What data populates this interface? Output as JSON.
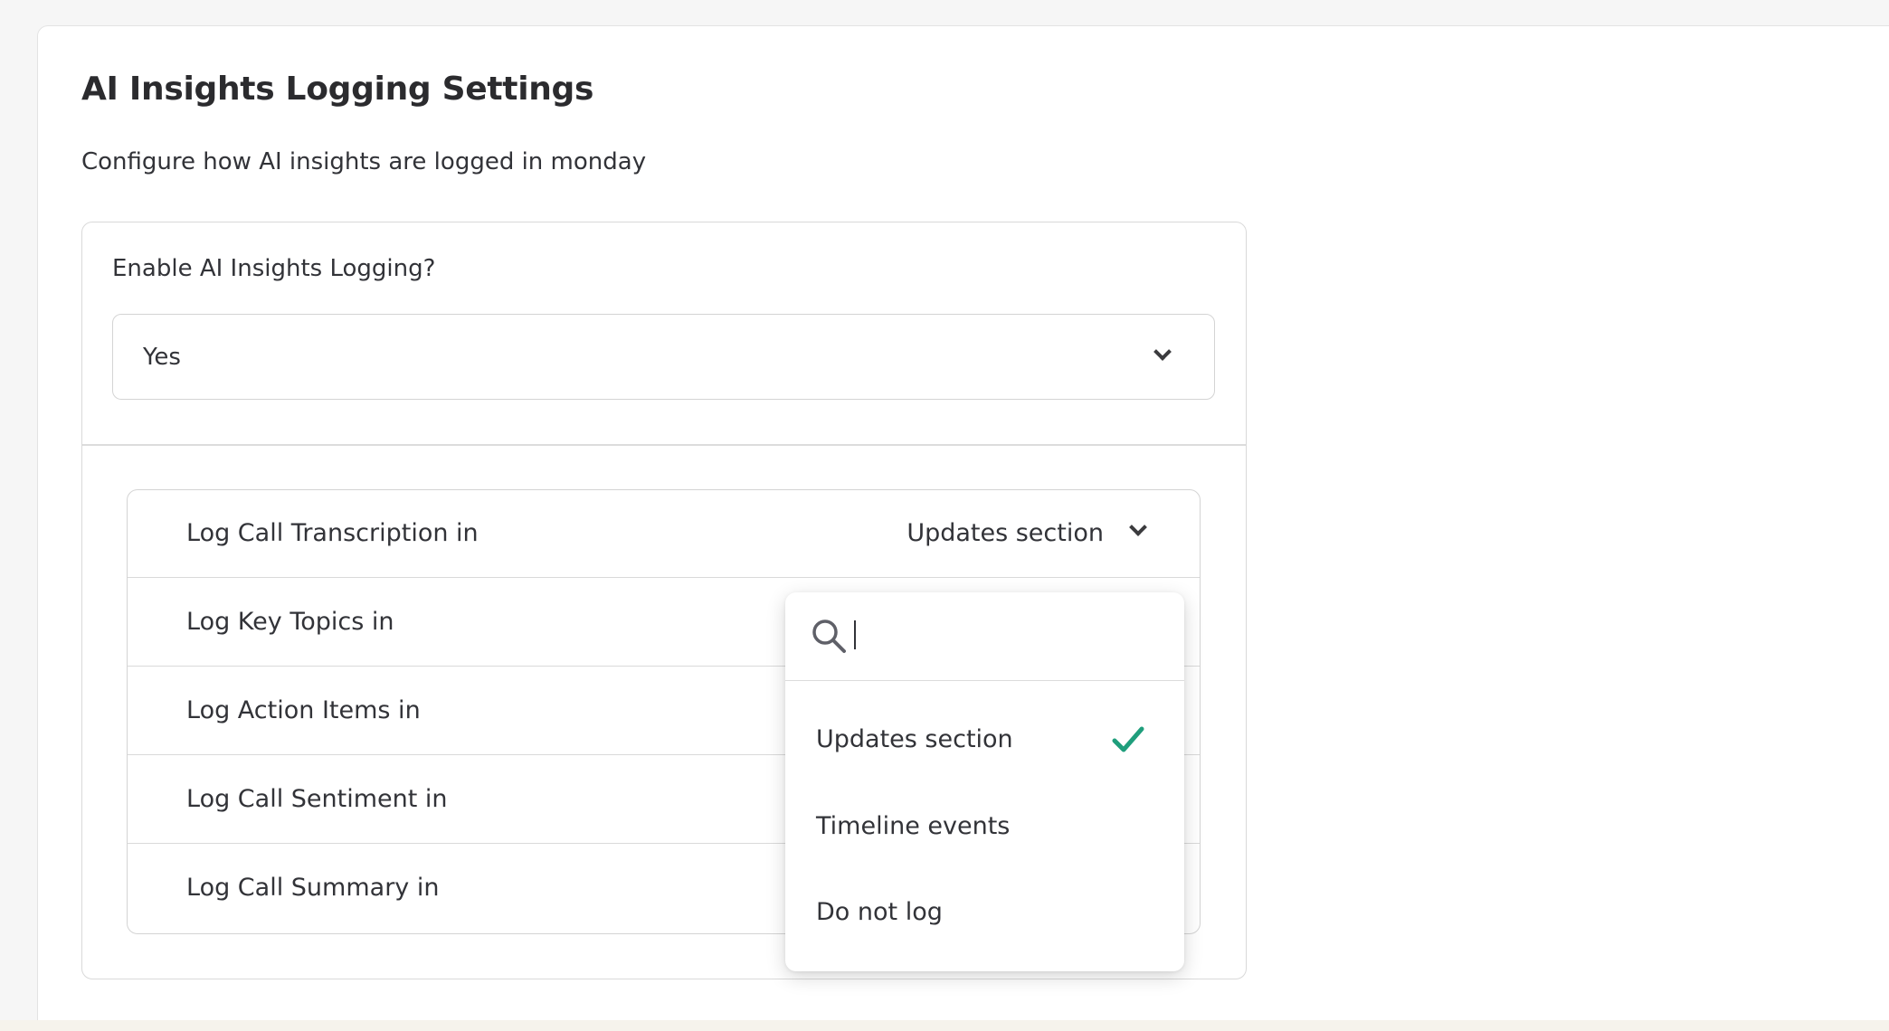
{
  "page": {
    "title": "AI Insights Logging Settings",
    "subtitle": "Configure how AI insights are logged in monday"
  },
  "enable": {
    "label": "Enable AI Insights Logging?",
    "value": "Yes"
  },
  "rows": [
    {
      "label": "Log Call Transcription in",
      "value": "Updates section"
    },
    {
      "label": "Log Key Topics in",
      "value": ""
    },
    {
      "label": "Log Action Items in",
      "value": ""
    },
    {
      "label": "Log Call Sentiment in",
      "value": ""
    },
    {
      "label": "Log Call Summary in",
      "value": ""
    }
  ],
  "dropdown": {
    "search_value": "",
    "options": [
      {
        "label": "Updates section",
        "selected": true
      },
      {
        "label": "Timeline events",
        "selected": false
      },
      {
        "label": "Do not log",
        "selected": false
      }
    ],
    "check_color": "#1f9e7c"
  },
  "icons": {
    "search": "search-icon",
    "chevron": "chevron-down-icon",
    "check": "check-icon"
  }
}
